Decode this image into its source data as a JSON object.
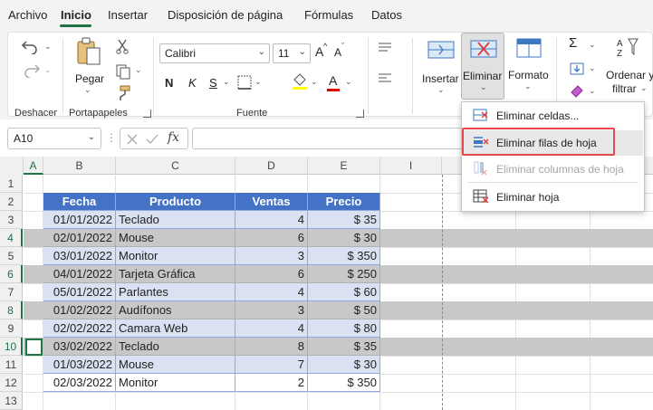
{
  "menu": {
    "tabs": [
      "Archivo",
      "Inicio",
      "Insertar",
      "Disposición de página",
      "Fórmulas",
      "Datos"
    ],
    "active": "Inicio"
  },
  "ribbon": {
    "undo_group": "Deshacer",
    "clipboard": {
      "paste_label": "Pegar",
      "group_label": "Portapapeles"
    },
    "font": {
      "name": "Calibri",
      "size": "11",
      "bold": "N",
      "italic": "K",
      "underline": "S",
      "font_color_letter": "A",
      "grow": "A",
      "shrink": "A",
      "group_label": "Fuente"
    },
    "cells": {
      "insert": "Insertar",
      "delete": "Eliminar",
      "format": "Formato"
    },
    "editing": {
      "sort_filter_line1": "Ordenar y",
      "sort_filter_line2": "filtrar"
    }
  },
  "formula_bar": {
    "name_box": "A10",
    "fx": "fx",
    "value": ""
  },
  "delete_menu": {
    "items": [
      {
        "label": "Eliminar celdas...",
        "enabled": true
      },
      {
        "label": "Eliminar filas de hoja",
        "enabled": true,
        "highlighted": true
      },
      {
        "label": "Eliminar columnas de hoja",
        "enabled": false
      },
      {
        "label": "Eliminar hoja",
        "enabled": true
      }
    ]
  },
  "grid": {
    "columns": [
      "A",
      "B",
      "C",
      "D",
      "E",
      "I"
    ],
    "row_numbers": [
      "1",
      "2",
      "3",
      "4",
      "5",
      "6",
      "7",
      "8",
      "9",
      "10",
      "11",
      "12",
      "13"
    ],
    "table_headers": [
      "Fecha",
      "Producto",
      "Ventas",
      "Precio"
    ],
    "rows": [
      {
        "fecha": "01/01/2022",
        "producto": "Teclado",
        "ventas": "4",
        "precio": "$ 35"
      },
      {
        "fecha": "02/01/2022",
        "producto": "Mouse",
        "ventas": "6",
        "precio": "$ 30"
      },
      {
        "fecha": "03/01/2022",
        "producto": "Monitor",
        "ventas": "3",
        "precio": "$ 350"
      },
      {
        "fecha": "04/01/2022",
        "producto": "Tarjeta Gráfica",
        "ventas": "6",
        "precio": "$ 250"
      },
      {
        "fecha": "05/01/2022",
        "producto": "Parlantes",
        "ventas": "4",
        "precio": "$ 60"
      },
      {
        "fecha": "01/02/2022",
        "producto": "Audífonos",
        "ventas": "3",
        "precio": "$ 50"
      },
      {
        "fecha": "02/02/2022",
        "producto": "Camara Web",
        "ventas": "4",
        "precio": "$ 80"
      },
      {
        "fecha": "03/02/2022",
        "producto": "Teclado",
        "ventas": "8",
        "precio": "$ 35"
      },
      {
        "fecha": "01/03/2022",
        "producto": "Mouse",
        "ventas": "7",
        "precio": "$ 30"
      },
      {
        "fecha": "02/03/2022",
        "producto": "Monitor",
        "ventas": "2",
        "precio": "$ 350"
      }
    ],
    "selected_rows": [
      "4",
      "6",
      "8",
      "10"
    ],
    "active_cell": "A10"
  },
  "colors": {
    "accent": "#217346",
    "table_header": "#4472c4",
    "table_band": "#d9e1f2",
    "selection": "#c8c8c8",
    "highlight_box": "#e8474a"
  }
}
